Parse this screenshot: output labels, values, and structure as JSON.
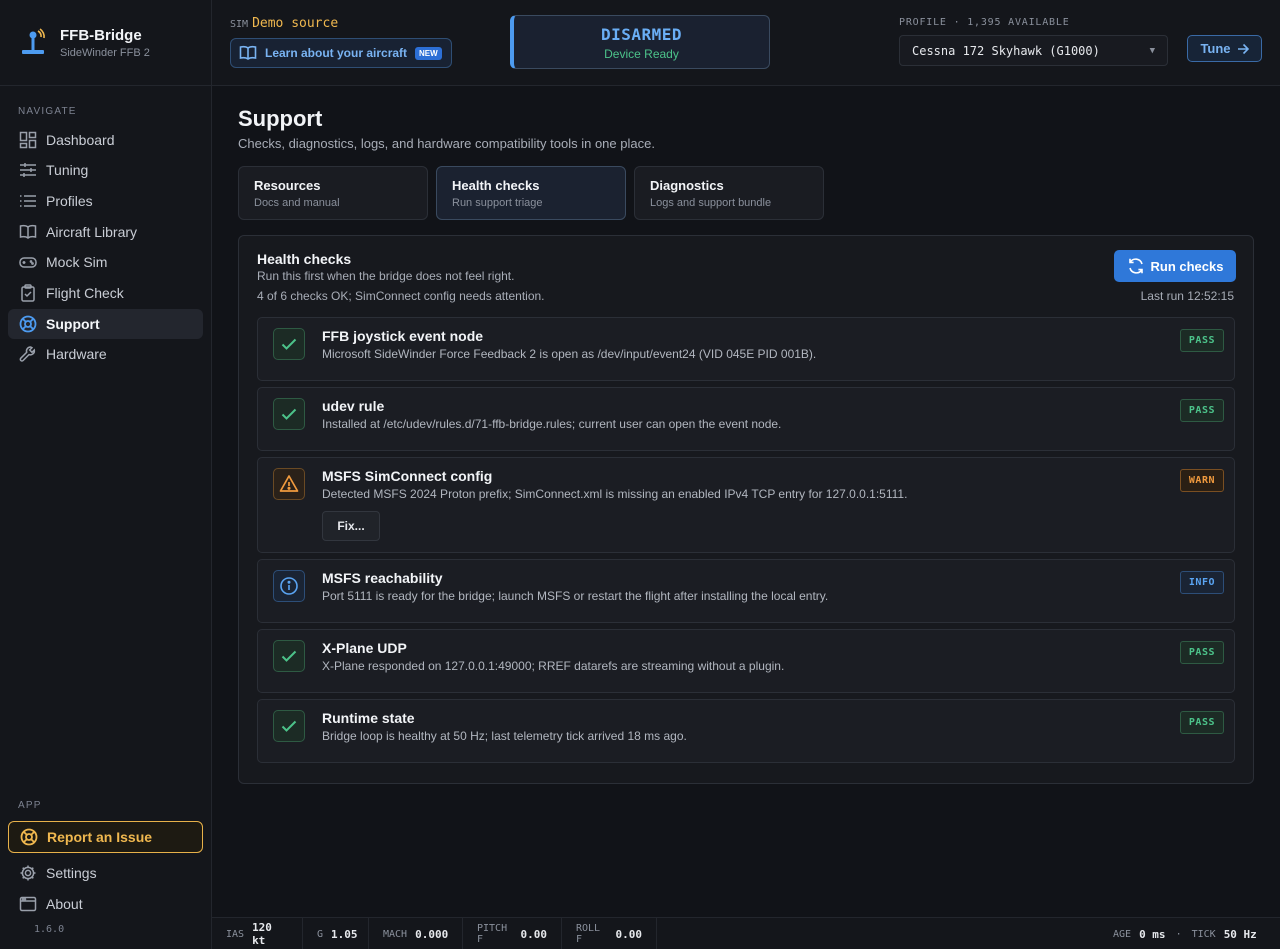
{
  "brand": {
    "name": "FFB-Bridge",
    "subtitle": "SideWinder FFB 2"
  },
  "sidebar": {
    "nav_label": "NAVIGATE",
    "items": [
      {
        "label": "Dashboard",
        "icon": "dashboard-icon"
      },
      {
        "label": "Tuning",
        "icon": "sliders-icon"
      },
      {
        "label": "Profiles",
        "icon": "list-icon"
      },
      {
        "label": "Aircraft Library",
        "icon": "book-icon"
      },
      {
        "label": "Mock Sim",
        "icon": "gamepad-icon"
      },
      {
        "label": "Flight Check",
        "icon": "clipboard-check-icon"
      },
      {
        "label": "Support",
        "icon": "lifebuoy-icon",
        "active": true
      },
      {
        "label": "Hardware",
        "icon": "wrench-icon"
      }
    ],
    "app_label": "APP",
    "report_label": "Report an Issue",
    "settings_label": "Settings",
    "about_label": "About",
    "version": "1.6.0"
  },
  "header": {
    "sim_label": "SIM",
    "sim_source": "Demo source",
    "learn_label": "Learn about your aircraft",
    "new_badge": "NEW",
    "status_main": "DISARMED",
    "status_sub": "Device Ready",
    "profile_label": "PROFILE · 1,395 AVAILABLE",
    "profile_value": "Cessna 172 Skyhawk (G1000)",
    "tune_label": "Tune"
  },
  "page": {
    "title": "Support",
    "subtitle": "Checks, diagnostics, logs, and hardware compatibility tools in one place.",
    "tabs": [
      {
        "title": "Resources",
        "sub": "Docs and manual"
      },
      {
        "title": "Health checks",
        "sub": "Run support triage"
      },
      {
        "title": "Diagnostics",
        "sub": "Logs and support bundle"
      }
    ]
  },
  "panel": {
    "title": "Health checks",
    "subtitle": "Run this first when the bridge does not feel right.",
    "summary": "4 of 6 checks OK; SimConnect config needs attention.",
    "run_label": "Run checks",
    "last_run": "Last run 12:52:15",
    "checks": [
      {
        "title": "FFB joystick event node",
        "desc": "Microsoft SideWinder Force Feedback 2 is open as /dev/input/event24 (VID 045E PID 001B).",
        "status": "PASS",
        "kind": "pass"
      },
      {
        "title": "udev rule",
        "desc": "Installed at /etc/udev/rules.d/71-ffb-bridge.rules; current user can open the event node.",
        "status": "PASS",
        "kind": "pass"
      },
      {
        "title": "MSFS SimConnect config",
        "desc": "Detected MSFS 2024 Proton prefix; SimConnect.xml is missing an enabled IPv4 TCP entry for 127.0.0.1:5111.",
        "status": "WARN",
        "kind": "warn",
        "action": "Fix..."
      },
      {
        "title": "MSFS reachability",
        "desc": "Port 5111 is ready for the bridge; launch MSFS or restart the flight after installing the local entry.",
        "status": "INFO",
        "kind": "info"
      },
      {
        "title": "X-Plane UDP",
        "desc": "X-Plane responded on 127.0.0.1:49000; RREF datarefs are streaming without a plugin.",
        "status": "PASS",
        "kind": "pass"
      },
      {
        "title": "Runtime state",
        "desc": "Bridge loop is healthy at 50 Hz; last telemetry tick arrived 18 ms ago.",
        "status": "PASS",
        "kind": "pass"
      }
    ]
  },
  "footer": {
    "ias_label": "IAS",
    "ias_value": "120 kt",
    "g_label": "G",
    "g_value": "1.05",
    "mach_label": "MACH",
    "mach_value": "0.000",
    "pitch_label": "PITCH F",
    "pitch_value": "0.00",
    "roll_label": "ROLL F",
    "roll_value": "0.00",
    "age_label": "AGE",
    "age_value": "0 ms",
    "sep": "·",
    "tick_label": "TICK",
    "tick_value": "50 Hz"
  },
  "colors": {
    "accent": "#2f78d9",
    "pass": "#4cc38a",
    "warn": "#f09a3e",
    "info": "#5aa4f2",
    "report": "#f0b84f"
  }
}
